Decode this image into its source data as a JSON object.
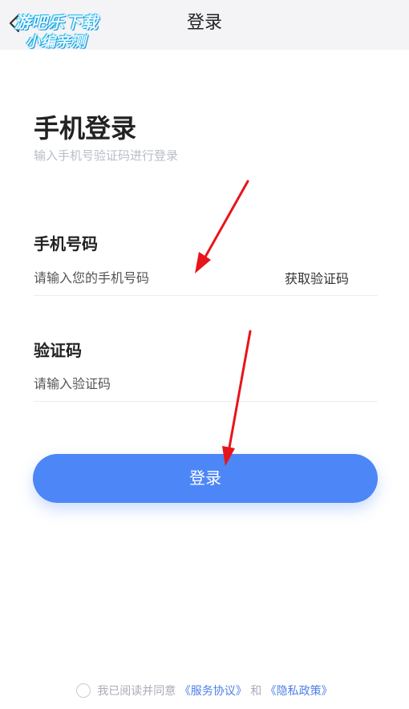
{
  "header": {
    "title": "登录",
    "back_icon": "chevron-left-icon"
  },
  "watermark": {
    "line1": "游吧乐下载",
    "line2": "小编亲测"
  },
  "login": {
    "title": "手机登录",
    "subtitle": "输入手机号验证码进行登录"
  },
  "phone": {
    "label": "手机号码",
    "placeholder": "请输入您的手机号码",
    "get_code": "获取验证码"
  },
  "code": {
    "label": "验证码",
    "placeholder": "请输入验证码"
  },
  "submit": {
    "label": "登录"
  },
  "agreement": {
    "prefix": "我已阅读并同意",
    "service_link": "《服务协议》",
    "and": "和",
    "privacy_link": "《隐私政策》"
  },
  "colors": {
    "primary": "#4d86f7",
    "link": "#4d7fe8",
    "annotation_arrow": "#e8141b"
  }
}
